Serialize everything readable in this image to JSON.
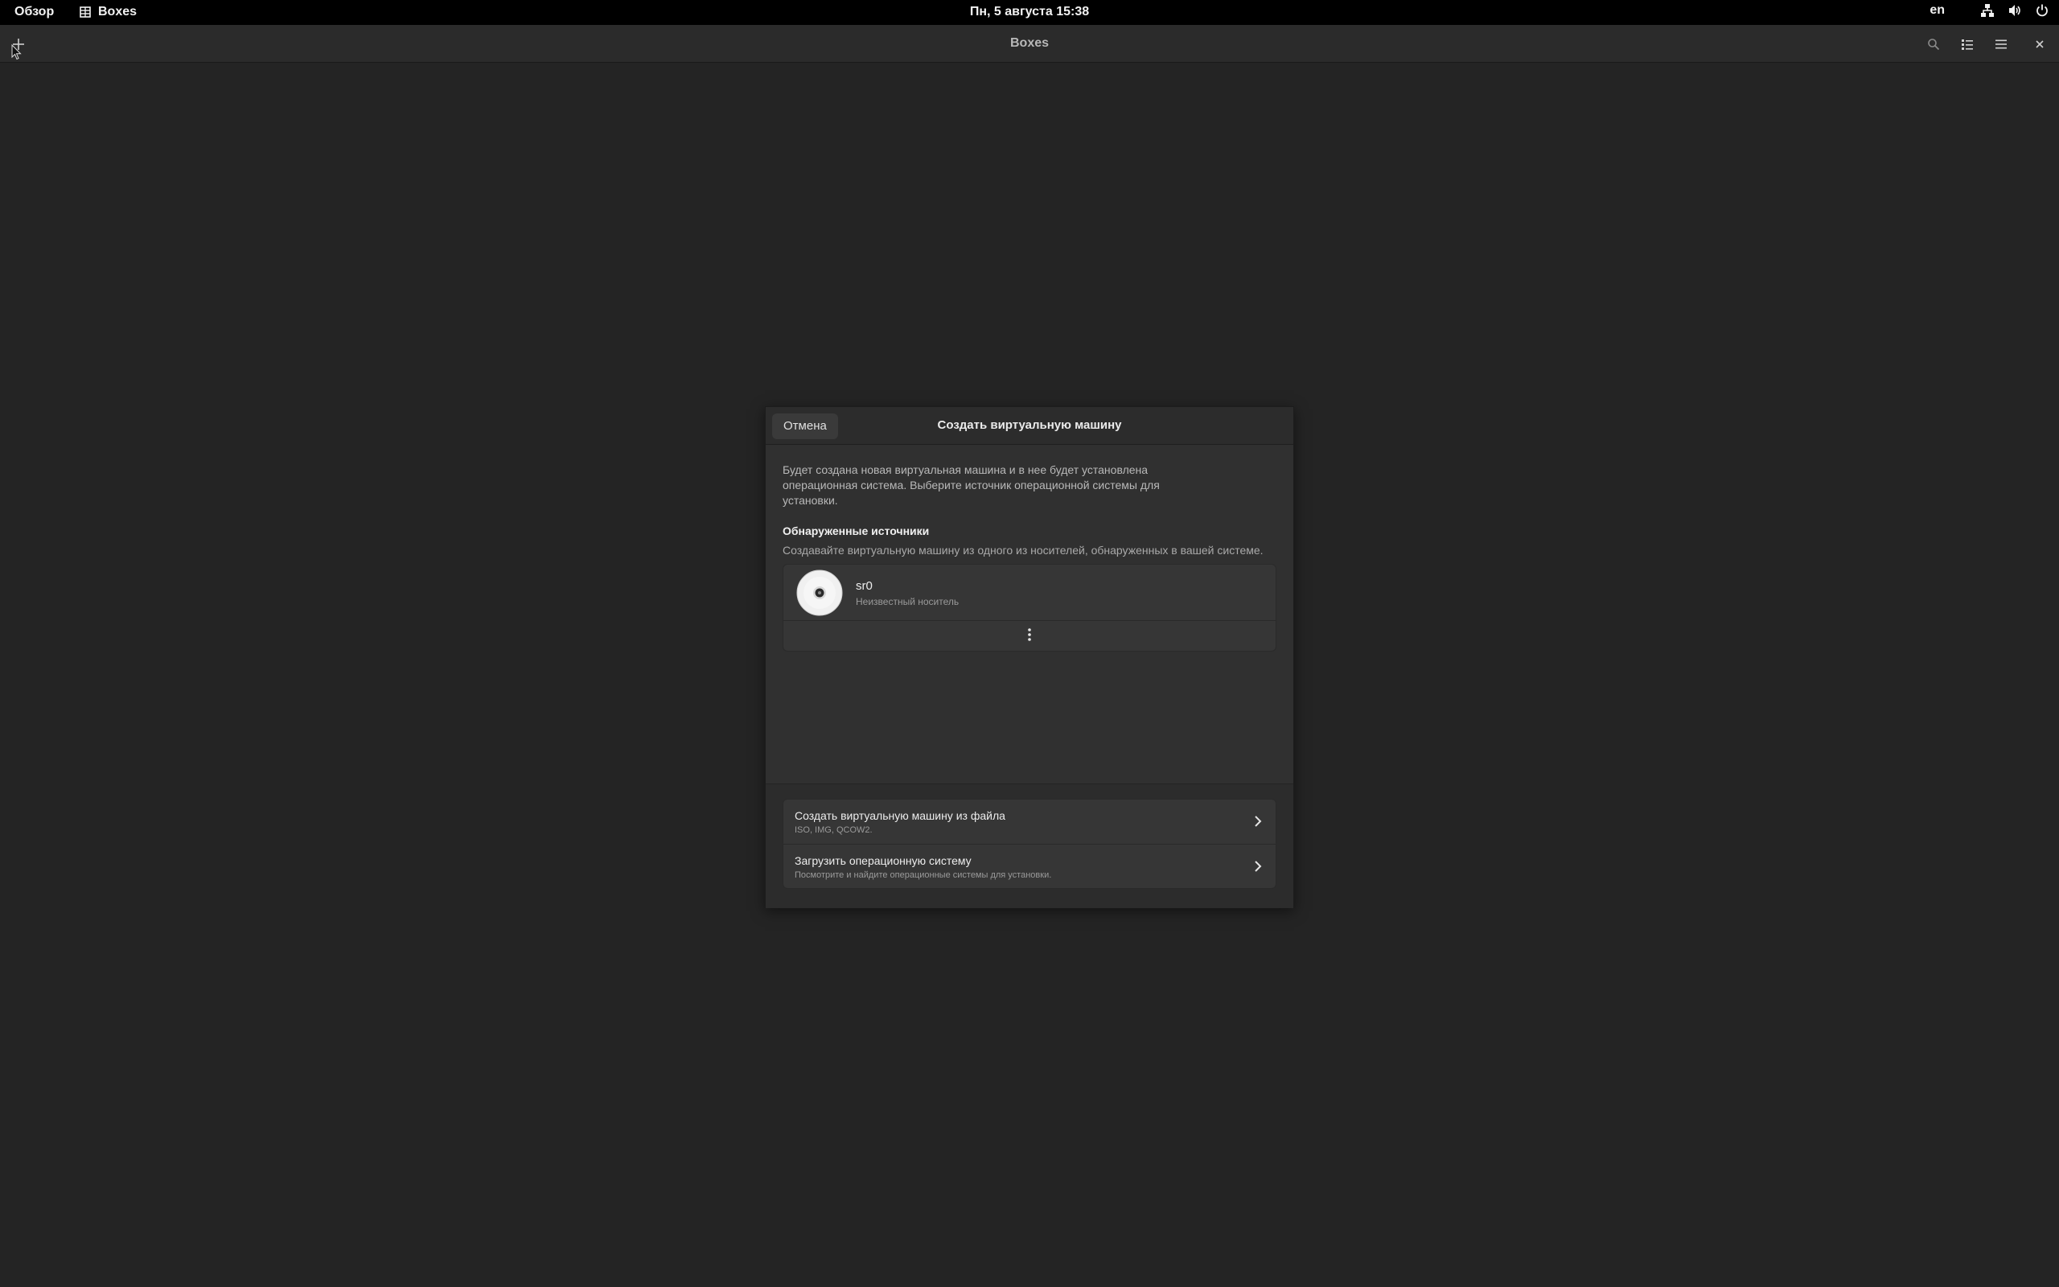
{
  "topbar": {
    "overview_label": "Обзор",
    "app_name": "Boxes",
    "clock": "Пн, 5 августа  15:38",
    "lang": "en"
  },
  "window": {
    "title": "Boxes"
  },
  "dialog": {
    "cancel_label": "Отмена",
    "title": "Создать виртуальную машину",
    "intro": "Будет создана новая виртуальная машина и в нее будет установлена операционная система. Выберите источник операционной системы для установки.",
    "detected_title": "Обнаруженные источники",
    "detected_subtitle": "Создавайте виртуальную машину из одного из носителей, обнаруженных в вашей системе.",
    "media": [
      {
        "name": "sr0",
        "description": "Неизвестный носитель"
      }
    ],
    "options": [
      {
        "title": "Создать виртуальную машину из файла",
        "subtitle": "ISO, IMG, QCOW2."
      },
      {
        "title": "Загрузить операционную систему",
        "subtitle": "Посмотрите и найдите операционные системы для установки."
      }
    ]
  }
}
